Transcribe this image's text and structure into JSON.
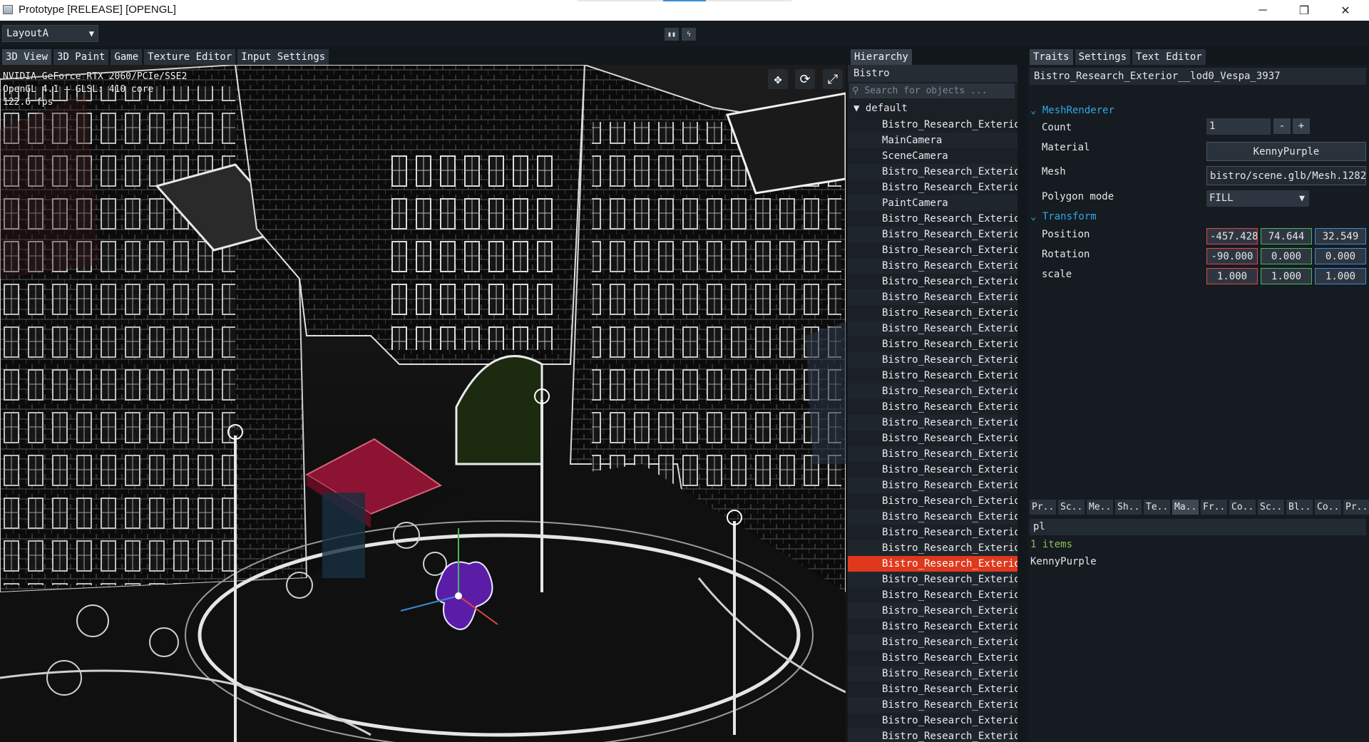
{
  "window": {
    "title": "Prototype [RELEASE] [OPENGL]",
    "controls": {
      "minimize": "─",
      "restore": "❐",
      "close": "✕"
    }
  },
  "toolbar": {
    "layout": "LayoutA",
    "pause_icon": "▮▮",
    "step_icon": "ϟ"
  },
  "viewport_tabs": [
    "3D View",
    "3D Paint",
    "Game",
    "Texture Editor",
    "Input Settings"
  ],
  "viewport": {
    "gpu_line": "NVIDIA GeForce RTX 2060/PCIe/SSE2",
    "gl_line": "OpenGL 4.1 — GLSL: 410 core",
    "fps": "122.6 fps",
    "icons": [
      "move-icon",
      "refresh-icon",
      "expand-icon"
    ]
  },
  "hierarchy": {
    "tab": "Hierarchy",
    "root": "Bistro",
    "search_placeholder": "Search for objects ...",
    "group": "default",
    "items": [
      "Bistro_Research_Exterior",
      "MainCamera",
      "SceneCamera",
      "Bistro_Research_Exterior",
      "Bistro_Research_Exterior",
      "PaintCamera",
      "Bistro_Research_Exterior",
      "Bistro_Research_Exterior",
      "Bistro_Research_Exterior",
      "Bistro_Research_Exterior",
      "Bistro_Research_Exterior",
      "Bistro_Research_Exterior",
      "Bistro_Research_Exterior",
      "Bistro_Research_Exterior",
      "Bistro_Research_Exterior",
      "Bistro_Research_Exterior",
      "Bistro_Research_Exterior",
      "Bistro_Research_Exterior",
      "Bistro_Research_Exterior",
      "Bistro_Research_Exterior",
      "Bistro_Research_Exterior",
      "Bistro_Research_Exterior",
      "Bistro_Research_Exterior",
      "Bistro_Research_Exterior",
      "Bistro_Research_Exterior",
      "Bistro_Research_Exterior",
      "Bistro_Research_Exterior",
      "Bistro_Research_Exterior",
      "Bistro_Research_Exterior",
      "Bistro_Research_Exterior",
      "Bistro_Research_Exterior",
      "Bistro_Research_Exterior",
      "Bistro_Research_Exterior",
      "Bistro_Research_Exterior",
      "Bistro_Research_Exterior",
      "Bistro_Research_Exterior",
      "Bistro_Research_Exterior",
      "Bistro_Research_Exterior",
      "Bistro_Research_Exterior",
      "Bistro_Research_Exterior"
    ],
    "selected_index": 28
  },
  "traits": {
    "tabs": [
      "Traits",
      "Settings",
      "Text Editor"
    ],
    "object_name": "Bistro_Research_Exterior__lod0_Vespa_3937",
    "mesh_renderer": {
      "header": "MeshRenderer",
      "count_label": "Count",
      "count_value": "1",
      "minus": "-",
      "plus": "+",
      "material_label": "Material",
      "material_value": "KennyPurple",
      "mesh_label": "Mesh",
      "mesh_value": "bistro/scene.glb/Mesh.1282",
      "polygon_label": "Polygon mode",
      "polygon_value": "FILL"
    },
    "transform": {
      "header": "Transform",
      "position_label": "Position",
      "position": [
        "-457.428",
        "74.644",
        "32.549"
      ],
      "rotation_label": "Rotation",
      "rotation": [
        "-90.000",
        "0.000",
        "0.000"
      ],
      "scale_label": "scale",
      "scale": [
        "1.000",
        "1.000",
        "1.000"
      ]
    }
  },
  "assets": {
    "tabs": [
      "Pr...",
      "Sc...",
      "Me...",
      "Sh...",
      "Te...",
      "Ma...",
      "Fr...",
      "Co...",
      "Sc...",
      "Bl...",
      "Co...",
      "Pr..."
    ],
    "active_tab_index": 5,
    "search_value": "pl",
    "count_text": "1 items",
    "items": [
      "KennyPurple"
    ]
  },
  "colors": {
    "selection": "#e0381d",
    "section_header": "#2ea8e6",
    "x_axis": "#e34545",
    "y_axis": "#47b85a",
    "z_axis": "#3a8ad6",
    "awning": "#8c1432",
    "vespa": "#5b1da8"
  }
}
